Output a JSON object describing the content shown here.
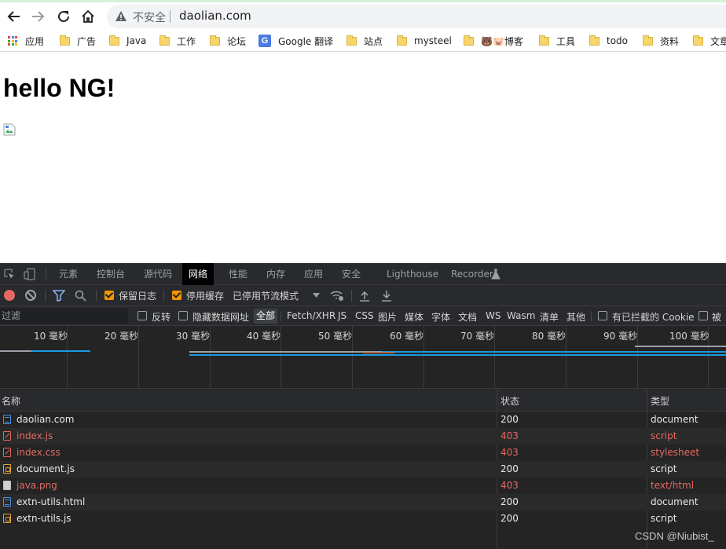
{
  "browser": {
    "insecure_label": "不安全",
    "url": "daolian.com",
    "bookmarks": [
      "应用",
      "广告",
      "Java",
      "工作",
      "论坛",
      "Google 翻译",
      "站点",
      "mysteel",
      "🐻🐷博客",
      "工具",
      "todo",
      "资料",
      "文章"
    ]
  },
  "page": {
    "heading": "hello NG!"
  },
  "devtools": {
    "tabs": [
      "元素",
      "控制台",
      "源代码",
      "网络",
      "性能",
      "内存",
      "应用",
      "安全",
      "Lighthouse",
      "Recorder"
    ],
    "active_tab": "网络",
    "controls": {
      "preserve_log": "保留日志",
      "disable_cache": "停用缓存",
      "throttle": "已停用节流模式"
    },
    "filter": {
      "placeholder": "过滤",
      "invert": "反转",
      "hide_data_urls": "隐藏数据网址",
      "types": [
        "全部",
        "Fetch/XHR",
        "JS",
        "CSS",
        "图片",
        "媒体",
        "字体",
        "文档",
        "WS",
        "Wasm",
        "清单",
        "其他"
      ],
      "blocked_cookies": "有已拦截的 Cookie",
      "blocked_requests": "被屏"
    },
    "timeline_ticks": [
      "10 毫秒",
      "20 毫秒",
      "30 毫秒",
      "40 毫秒",
      "50 毫秒",
      "60 毫秒",
      "70 毫秒",
      "80 毫秒",
      "90 毫秒",
      "100 毫秒"
    ],
    "table": {
      "headers": {
        "name": "名称",
        "status": "状态",
        "type": "类型"
      },
      "rows": [
        {
          "name": "daolian.com",
          "status": "200",
          "type": "document",
          "icon": "document-icon",
          "error": false
        },
        {
          "name": "index.js",
          "status": "403",
          "type": "script",
          "icon": "script-error-icon",
          "error": true
        },
        {
          "name": "index.css",
          "status": "403",
          "type": "stylesheet",
          "icon": "stylesheet-error-icon",
          "error": true
        },
        {
          "name": "document.js",
          "status": "200",
          "type": "script",
          "icon": "script-icon",
          "error": false
        },
        {
          "name": "java.png",
          "status": "403",
          "type": "text/html",
          "icon": "image-icon",
          "error": true
        },
        {
          "name": "extn-utils.html",
          "status": "200",
          "type": "document",
          "icon": "document-icon",
          "error": false
        },
        {
          "name": "extn-utils.js",
          "status": "200",
          "type": "script",
          "icon": "script-icon",
          "error": false
        }
      ]
    },
    "colors": {
      "error": "#e46962",
      "normal": "#e8eaed",
      "accent": "#f29900"
    }
  },
  "watermark": "CSDN @Niubist_"
}
